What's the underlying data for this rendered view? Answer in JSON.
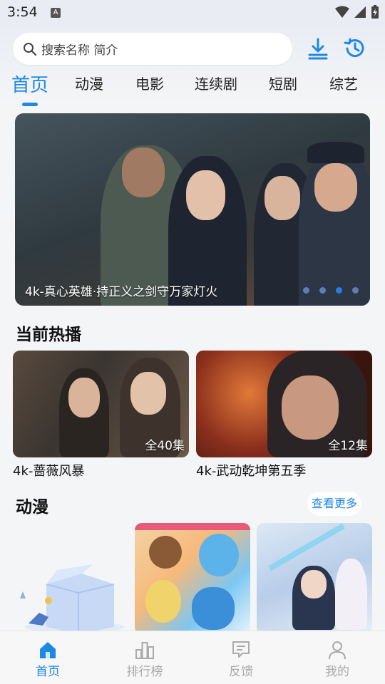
{
  "status_bar": {
    "time": "3:54"
  },
  "search": {
    "placeholder": "搜索名称 简介"
  },
  "tabs": [
    {
      "label": "首页",
      "active": true
    },
    {
      "label": "动漫"
    },
    {
      "label": "电影"
    },
    {
      "label": "连续剧"
    },
    {
      "label": "短剧"
    },
    {
      "label": "综艺"
    }
  ],
  "banner": {
    "caption": "4k-真心英雄·持正义之剑守万家灯火",
    "slide_count": 4,
    "active_slide": 3
  },
  "hot": {
    "title": "当前热播",
    "items": [
      {
        "title": "4k-蔷薇风暴",
        "badge": "全40集"
      },
      {
        "title": "4k-武动乾坤第五季",
        "badge": "全12集"
      }
    ]
  },
  "anime": {
    "title": "动漫",
    "more_label": "查看更多"
  },
  "bottom_nav": [
    {
      "label": "首页",
      "icon": "home-icon",
      "active": true
    },
    {
      "label": "排行榜",
      "icon": "ranking-icon"
    },
    {
      "label": "反馈",
      "icon": "feedback-icon"
    },
    {
      "label": "我的",
      "icon": "profile-icon"
    }
  ],
  "colors": {
    "accent": "#1e88e5",
    "inactive_nav": "#aaaaaa",
    "background": "#f4f5f7"
  }
}
